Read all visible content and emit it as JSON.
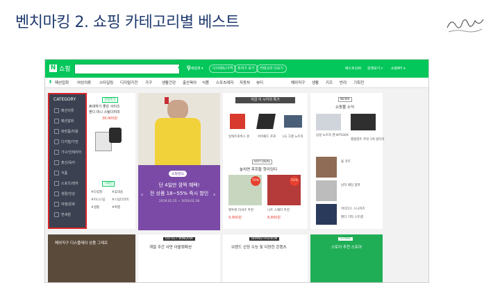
{
  "slide": {
    "title": "벤치마킹 2. 쇼핑 카테고리별 베스트"
  },
  "header": {
    "logo_letter": "N",
    "logo_text": "쇼핑",
    "search_dropdown": "▼",
    "links": [
      "상세검색 ▾",
      "다이렉트/가격",
      "최저가 보기",
      "카테고리 더보기"
    ],
    "best": "베스트100",
    "user": "원래보기↗",
    "my": "쇼핑MY ▾"
  },
  "catnav": [
    "패션잡화",
    "여성의류",
    "스타일링",
    "디지털가전",
    "가구",
    "생활건강",
    "출산육아",
    "식품",
    "스포츠레저",
    "자동차",
    "뷰티",
    "해외직구",
    "생활",
    "키즈",
    "반려",
    "기획전"
  ],
  "sidebar": {
    "title": "CATEGORY",
    "items": [
      "패션의류",
      "패션잡화",
      "화장품/미용",
      "디지털/가전",
      "가구/인테리어",
      "출산/육아",
      "식품",
      "스포츠/레저",
      "생활/건강",
      "여행/문화",
      "면세점"
    ]
  },
  "panel1": {
    "tag": "한정특가",
    "title_line1": "휴대하기 좋은 사이즈",
    "title_line2": "핸디 미니 스팀다리미",
    "price": "39,900원",
    "tag2": "기획전",
    "chips": [
      "#다림질",
      "#휴대용",
      "#미니스팀",
      "#스팀다리미",
      "#생활",
      "#여행"
    ]
  },
  "promo": {
    "pill": "쇼핑윈도",
    "line1": "단 4일만 깜짝 혜택!",
    "line2": "전 상품 18~55% 즉시 할인",
    "date": "2019.02.25 ~ 2019.02.28"
  },
  "panel3": {
    "header": "지금 이 시각의 특가",
    "items": [
      {
        "name": "일렉트로룩스 온",
        "price": ""
      },
      {
        "name": "아이패드 프로",
        "price": ""
      },
      {
        "name": "LG 그램 노트북",
        "price": ""
      }
    ],
    "hot_label": "HOT DEAL",
    "hot_title": "놓치면 후회할 핫리딩티",
    "hot_items": [
      {
        "name": "맨투맨 티셔츠 추천",
        "price": "9,900원",
        "discount": "70%"
      },
      {
        "name": "니트 스웨터 추천",
        "price": "8,800원",
        "discount": "51%"
      }
    ]
  },
  "news": {
    "label": "NEWS",
    "title": "쇼핑몰 소식",
    "items": [
      "삼성 노트북 펜 NT930X",
      "캠핑텐트 추천 1위 원터치",
      "울 코트",
      "남자 패딩 점퍼",
      "아디다스 스니커즈",
      "펜더 기타 스트랩"
    ]
  },
  "bottom": {
    "b1": "해외직구 디스플레이 상품 그래프",
    "b2_label": "OUTLET WINDOW",
    "b2": "계절 주간 사연 아울렛패션",
    "b3_label": "BRAND FASHION",
    "b3": "브랜드 선정 수능 및 다양한 콘텐츠",
    "b4_label": "STORE",
    "b4": "스토어 추천 스토어"
  },
  "colors": {
    "naver_green": "#03c75a",
    "sidebar_bg": "#3b4150",
    "highlight_red": "#d8262a",
    "promo_purple": "#7a4aa6"
  }
}
